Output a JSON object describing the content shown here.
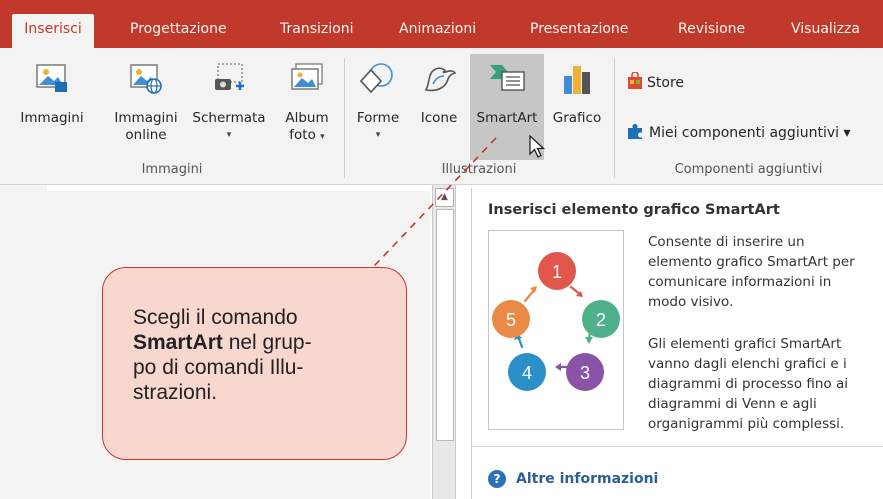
{
  "tabs": [
    {
      "label": "Inserisci",
      "active": true
    },
    {
      "label": "Progettazione"
    },
    {
      "label": "Transizioni"
    },
    {
      "label": "Animazioni"
    },
    {
      "label": "Presentazione"
    },
    {
      "label": "Revisione"
    },
    {
      "label": "Visualizza"
    }
  ],
  "ribbon": {
    "buttons": {
      "immagini": "Immagini",
      "immagini_online_1": "Immagini",
      "immagini_online_2": "online",
      "schermata": "Schermata",
      "album_1": "Album",
      "album_2": "foto",
      "forme": "Forme",
      "icone": "Icone",
      "smartart": "SmartArt",
      "grafico": "Grafico",
      "store": "Store",
      "miei_componenti": "Miei componenti aggiuntivi"
    },
    "caret": "▾",
    "groups": {
      "immagini": "Immagini",
      "illustrazioni": "Illustrazioni",
      "componenti": "Componenti aggiuntivi"
    }
  },
  "tooltip": {
    "title": "Inserisci elemento grafico SmartArt",
    "para1": [
      "Consente di inserire un",
      "elemento grafico SmartArt per",
      "comunicare informazioni in",
      "modo visivo."
    ],
    "para2": [
      "Gli elementi grafici SmartArt",
      "vanno dagli elenchi grafici e i",
      "diagrammi di processo fino ai",
      "diagrammi di Venn e agli",
      "organigrammi più complessi."
    ],
    "help_icon": "?",
    "help": "Altre informazioni",
    "diagram": {
      "nodes": [
        {
          "label": "1",
          "color": "#e0564a"
        },
        {
          "label": "2",
          "color": "#4fb08c"
        },
        {
          "label": "3",
          "color": "#8a54a6"
        },
        {
          "label": "4",
          "color": "#2b8fc8"
        },
        {
          "label": "5",
          "color": "#e98a47"
        }
      ]
    }
  },
  "callout": {
    "line1": "Scegli il comando",
    "bold": "SmartArt",
    "line2_rest": " nel grup-",
    "line3": "po di comandi Illu-",
    "line4": "strazioni."
  },
  "colors": {
    "accent": "#c0392b",
    "callout_fill": "#f8d8ce"
  }
}
